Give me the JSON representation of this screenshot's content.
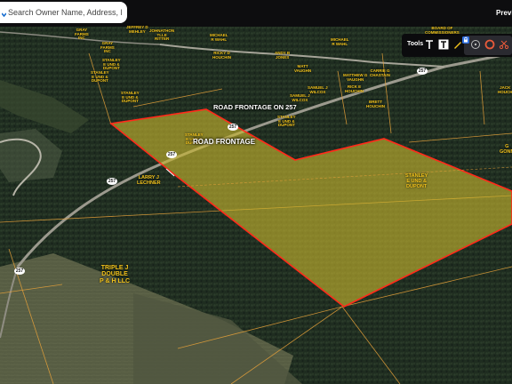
{
  "search": {
    "placeholder": "Search Owner Name, Address, Parcel Id"
  },
  "header": {
    "preview_label": "Previe"
  },
  "tools": {
    "label": "Tools",
    "icons": [
      "text-tool-icon",
      "text-box-tool-icon",
      "pencil-icon",
      "lock-icon",
      "radius-icon",
      "circle-icon",
      "scissors-icon"
    ]
  },
  "annotations": {
    "road_frontage_label": "ROAD FRONTAGE ON 257",
    "road_frontage": "ROAD FRONTAGE"
  },
  "route_shields": [
    "257",
    "257",
    "257",
    "257",
    "257"
  ],
  "owners": [
    "GRAY\nFARMS\nINC",
    "JEFFREY D\nMEHLEY",
    "JOHNATHON\nTLLE\nRITTER",
    "MICHAEL\nR WAHL",
    "BOARD OF\nCOMMISSIONERS",
    "GRAY\nFARMS\nINC",
    "STANLEY\nE UND &\nDUPONT",
    "RICKY D\nHOUCHIN",
    "ANDY B\nJONES",
    "MICHAEL\nR WAHL",
    "MATT\nVAUGHN",
    "CARRIE G\nCHASTAIN",
    "STANLEY\nE UND &\nDUPONT",
    "STANLEY\nE UND &\nDUPONT",
    "SAMUEL J\nWILCOX",
    "MATTHEW G\nVAUGHN",
    "SAMUEL J\nWILCOX",
    "RICK E\nHOUCHIN",
    "BRETT\nHOUCHIN",
    "JACK\nHOUCH",
    "STANLEY\nE UND &\nDUPONT",
    "STANLEY\nE UND &\nDUPONT",
    "LARRY J\nLECHNER",
    "STANLEY\nE UND &\nDUPONT",
    "G\nGONN",
    "TRIPLE J\nDOUBLE\nP & H LLC"
  ],
  "colors": {
    "parcel_fill": "#c8b62e",
    "parcel_outline": "#ff2a1a",
    "owner_label": "#f2c21b",
    "parcel_lines": "#e8a23a",
    "toolbar_bg": "#0b0b0d"
  }
}
